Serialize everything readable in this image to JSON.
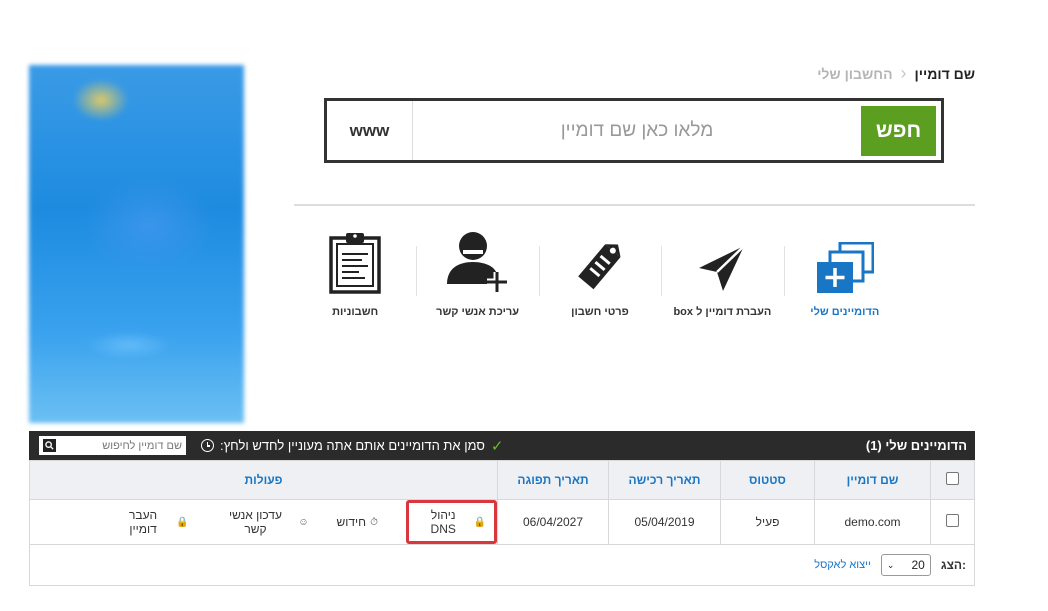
{
  "breadcrumb": {
    "root": "החשבון שלי",
    "current": "שם דומיין"
  },
  "search": {
    "prefix": "www",
    "placeholder": "מלאו כאן שם דומיין",
    "button": "חפש"
  },
  "actions": [
    {
      "label": "הדומיינים שלי",
      "icon": "my-domains-icon"
    },
    {
      "label": "העברת דומיין ל box",
      "icon": "transfer-plane-icon"
    },
    {
      "label": "פרטי חשבון",
      "icon": "account-tag-icon"
    },
    {
      "label": "עריכת אנשי קשר",
      "icon": "add-contact-icon"
    },
    {
      "label": "חשבוניות",
      "icon": "clipboard-icon"
    }
  ],
  "domains_panel": {
    "title": "הדומיינים שלי (1)",
    "hint": "סמן את הדומיינים אותם אתה מעוניין לחדש ולחץ:",
    "filter_placeholder": "שם דומיין לחיפוש",
    "columns": [
      "שם דומיין",
      "סטטוס",
      "תאריך רכישה",
      "תאריך תפוגה",
      "פעולות"
    ],
    "rows": [
      {
        "domain": "demo.com",
        "status": "פעיל",
        "purchase_date": "05/04/2019",
        "expiry_date": "06/04/2027",
        "actions": {
          "dns": "ניהול DNS",
          "renew": "חידוש",
          "contacts": "עדכון אנשי קשר",
          "transfer": "העבר דומיין"
        }
      }
    ],
    "footer": {
      "show_label": "הצג:",
      "page_size": "20",
      "export": "ייצוא לאקסל"
    }
  },
  "colors": {
    "accent": "#1976c4",
    "search_button": "#5c9e1f",
    "header_bg": "#2b2b2b",
    "highlight": "#d9363e"
  }
}
